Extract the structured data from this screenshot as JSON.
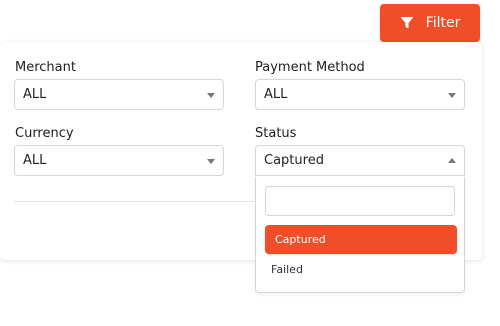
{
  "toolbar": {
    "filter_label": "Filter"
  },
  "filters": {
    "merchant": {
      "label": "Merchant",
      "value": "ALL"
    },
    "payment_method": {
      "label": "Payment Method",
      "value": "ALL"
    },
    "currency": {
      "label": "Currency",
      "value": "ALL"
    },
    "status": {
      "label": "Status",
      "value": "Captured",
      "search_value": "",
      "options": [
        "Captured",
        "Failed"
      ]
    }
  },
  "colors": {
    "accent": "#f04e28",
    "border": "#d6d6d6"
  },
  "icons": {
    "filter": "filter-funnel-icon",
    "select_closed": "caret-down-icon",
    "select_open": "caret-up-icon"
  }
}
